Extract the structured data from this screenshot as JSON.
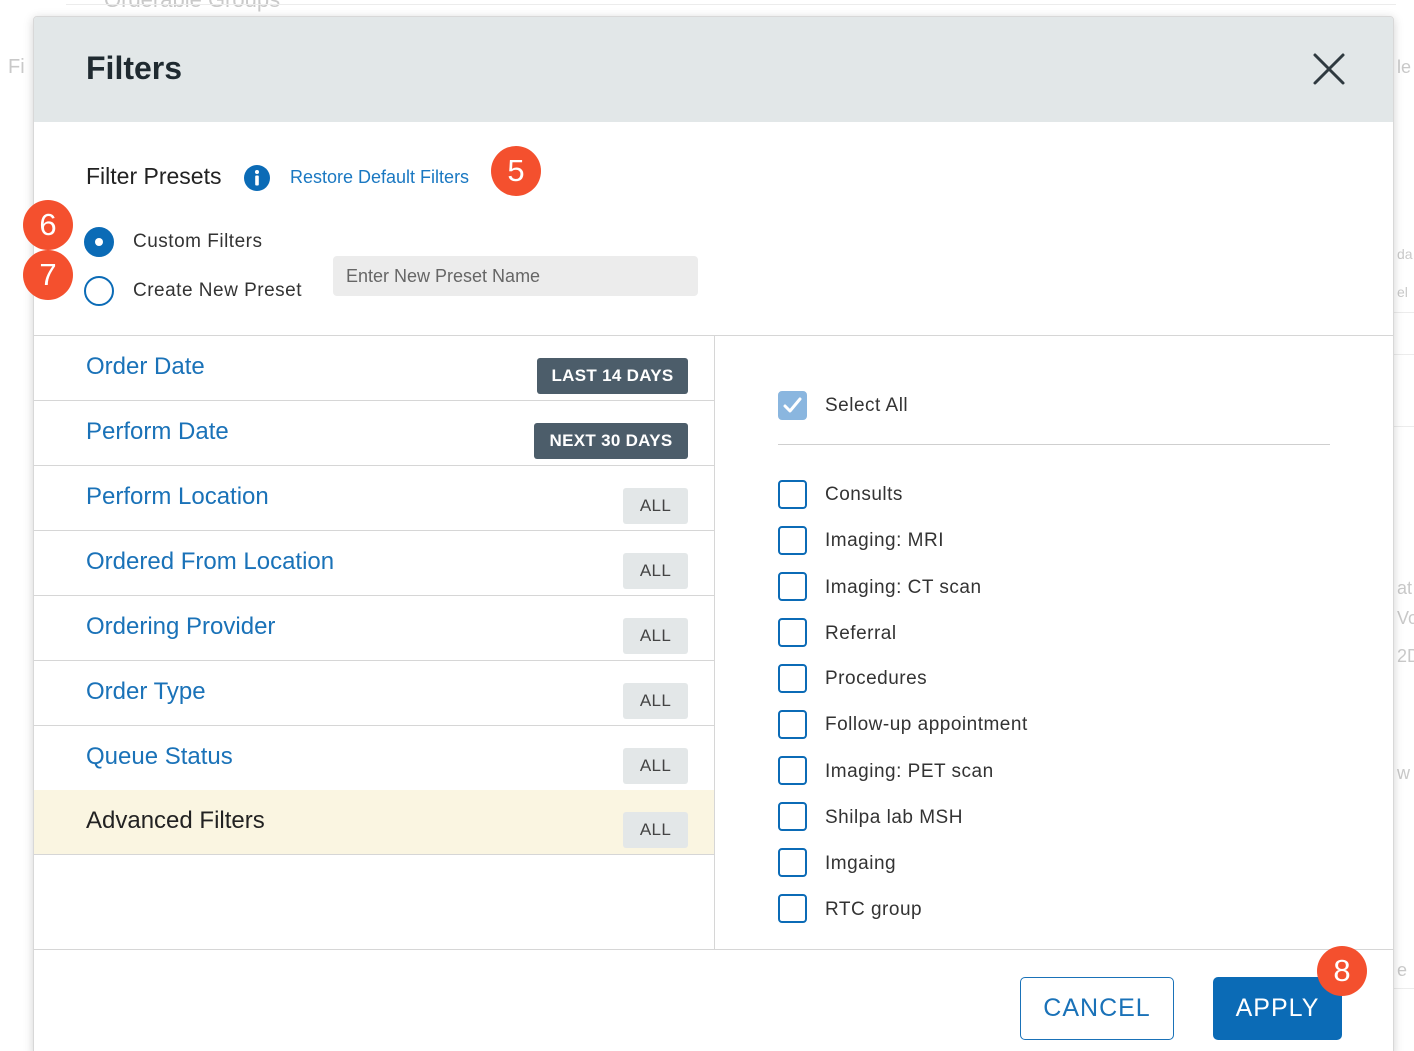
{
  "background": {
    "top_fragment": "Orderable Groups",
    "left_fragment": "Fi",
    "right_fragments": [
      "le",
      "da",
      "el",
      "at",
      "Vo",
      "2D",
      "w",
      "e"
    ]
  },
  "modal": {
    "title": "Filters",
    "close_icon": "close-icon",
    "presets": {
      "label": "Filter Presets",
      "info_icon": "info-icon",
      "restore_link": "Restore Default Filters",
      "options": [
        {
          "label": "Custom Filters",
          "selected": true
        },
        {
          "label": "Create New Preset",
          "selected": false
        }
      ],
      "new_preset_placeholder": "Enter New Preset Name"
    },
    "filters": [
      {
        "name": "Order Date",
        "badge": "LAST 14 DAYS",
        "badge_style": "dark",
        "active": false
      },
      {
        "name": "Perform Date",
        "badge": "NEXT 30 DAYS",
        "badge_style": "dark",
        "active": false
      },
      {
        "name": "Perform Location",
        "badge": "ALL",
        "badge_style": "light",
        "active": false
      },
      {
        "name": "Ordered From Location",
        "badge": "ALL",
        "badge_style": "light",
        "active": false
      },
      {
        "name": "Ordering Provider",
        "badge": "ALL",
        "badge_style": "light",
        "active": false
      },
      {
        "name": "Order Type",
        "badge": "ALL",
        "badge_style": "light",
        "active": false
      },
      {
        "name": "Queue Status",
        "badge": "ALL",
        "badge_style": "light",
        "active": false
      },
      {
        "name": "Advanced Filters",
        "badge": "ALL",
        "badge_style": "light",
        "active": true
      }
    ],
    "select_all": {
      "label": "Select All",
      "checked": true
    },
    "options": [
      {
        "label": "Consults",
        "checked": false
      },
      {
        "label": "Imaging: MRI",
        "checked": false
      },
      {
        "label": "Imaging: CT scan",
        "checked": false
      },
      {
        "label": "Referral",
        "checked": false
      },
      {
        "label": "Procedures",
        "checked": false
      },
      {
        "label": "Follow-up appointment",
        "checked": false
      },
      {
        "label": "Imaging: PET scan",
        "checked": false
      },
      {
        "label": "Shilpa lab MSH",
        "checked": false
      },
      {
        "label": "Imgaing",
        "checked": false
      },
      {
        "label": "RTC group",
        "checked": false
      }
    ],
    "footer": {
      "cancel_label": "CANCEL",
      "apply_label": "APPLY"
    }
  },
  "step_markers": [
    "5",
    "6",
    "7",
    "8"
  ],
  "colors": {
    "header_bg": "#e2e7e8",
    "link_blue": "#1a72b8",
    "primary_blue": "#0b6bb6",
    "active_row": "#faf5e1",
    "dark_badge": "#4c5d6a",
    "step_marker": "#f4502e"
  }
}
